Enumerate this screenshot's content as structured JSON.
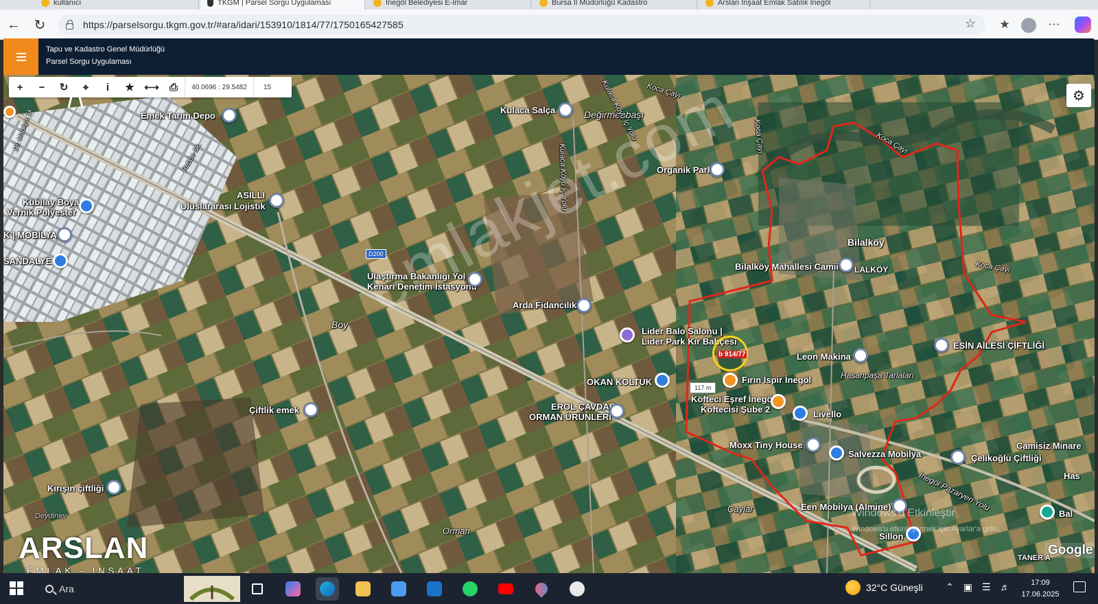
{
  "browser": {
    "tabs": [
      {
        "label": "kullanıcı"
      },
      {
        "label": "TKGM | Parsel Sorgu Uygulaması"
      },
      {
        "label": "İnegöl Belediyesi E-İmar"
      },
      {
        "label": "Bursa İl Müdürlüğü Kadastro"
      },
      {
        "label": "Arslan İnşaat Emlak Satılık İnegöl"
      }
    ],
    "url": "https://parselsorgu.tkgm.gov.tr/#ara/idari/153910/1814/77/1750165427585"
  },
  "app": {
    "title_line1": "Tapu ve Kadastro Genel Müdürlüğü",
    "title_line2": "Parsel Sorgu Uygulaması"
  },
  "map_toolbar": {
    "coordinates": "40.0696 : 29.5482",
    "zoom": "15"
  },
  "map": {
    "places": [
      {
        "id": "emek-tarim-depo",
        "label": "Emek Tarım Depo",
        "pin": "grey"
      },
      {
        "id": "kulaca-salca",
        "label": "Kulaca Salça",
        "pin": "grey"
      },
      {
        "id": "organik-park",
        "label": "Organik Park",
        "pin": "grey"
      },
      {
        "id": "asilli",
        "label": "ASILLI",
        "pin": "grey"
      },
      {
        "id": "uluslararasi-lojistik",
        "label": "Uluslararası Lojistik",
        "pin": "none"
      },
      {
        "id": "kubilay-boya",
        "label": "Kubilay Boya",
        "pin": "blue"
      },
      {
        "id": "vernik-polyester",
        "label": "Vernik Polyester",
        "pin": "none"
      },
      {
        "id": "k-mobilya",
        "label": "K | MOBİLYA",
        "pin": "grey"
      },
      {
        "id": "sandalye",
        "label": "SANDALYE",
        "pin": "blue"
      },
      {
        "id": "bilalkoy-camii",
        "label": "Bilalköy Mahallesi Camii",
        "pin": "grey"
      },
      {
        "id": "ulastirma-1",
        "label": "Ulaştırma Bakanlığı Yol",
        "pin": "grey"
      },
      {
        "id": "ulastirma-2",
        "label": "Kenarı Denetim İstasyonu",
        "pin": "none"
      },
      {
        "id": "arda-fidancilik",
        "label": "Arda Fidancılık",
        "pin": "grey"
      },
      {
        "id": "lider-balo-1",
        "label": "Lider Balo Salonu |",
        "pin": "purple"
      },
      {
        "id": "lider-balo-2",
        "label": "Lider Park Kır Bahçesi",
        "pin": "none"
      },
      {
        "id": "leon-makina",
        "label": "Leon Makina",
        "pin": "grey"
      },
      {
        "id": "esin-ailesi",
        "label": "ESİN AİLESİ ÇİFTLİĞİ",
        "pin": "grey"
      },
      {
        "id": "firin-ispir",
        "label": "Fırın İspir İnegöl",
        "pin": "orange"
      },
      {
        "id": "okan-koltuk",
        "label": "OKAN KOLTUK",
        "pin": "blue"
      },
      {
        "id": "koftecisi-1",
        "label": "Köfteci Eşref İnegöl",
        "pin": "orange"
      },
      {
        "id": "koftecisi-2",
        "label": "Köftecisi Şube 2",
        "pin": "none"
      },
      {
        "id": "livello",
        "label": "Livello",
        "pin": "blue"
      },
      {
        "id": "ciftlik-emek",
        "label": "Çiftlik emek",
        "pin": "grey"
      },
      {
        "id": "erol-cavdar-1",
        "label": "EROL ÇAVDAR",
        "pin": "grey"
      },
      {
        "id": "erol-cavdar-2",
        "label": "ORMAN ÜRÜNLERİ",
        "pin": "none"
      },
      {
        "id": "moxx",
        "label": "Moxx Tiny House",
        "pin": "grey"
      },
      {
        "id": "salvezza",
        "label": "Salvezza Mobilya",
        "pin": "blue"
      },
      {
        "id": "camisiz-minare",
        "label": "Camisiz Minare",
        "pin": "none"
      },
      {
        "id": "celikoglu",
        "label": "Çelikoğlu Çiftliği",
        "pin": "grey"
      },
      {
        "id": "kirisin",
        "label": "Kırışın çiftliği",
        "pin": "grey"
      },
      {
        "id": "een-mobilya",
        "label": "Een Mobilya (Almine)",
        "pin": "grey"
      },
      {
        "id": "sillon",
        "label": "Sillon",
        "pin": "blue"
      },
      {
        "id": "bal",
        "label": "Bal",
        "pin": "teal"
      },
      {
        "id": "has",
        "label": "Has",
        "pin": "none"
      },
      {
        "id": "taner",
        "label": "TANER A",
        "pin": "none"
      }
    ],
    "areas": [
      {
        "id": "bilalkoy",
        "label": "Bilalköy"
      },
      {
        "id": "bilalkoy-short",
        "label": "LALKÖY"
      },
      {
        "id": "degirmenbasi",
        "label": "Değirmenbaşı"
      },
      {
        "id": "boy",
        "label": "Boy"
      },
      {
        "id": "hasanpasa",
        "label": "Hasanpaşa Tarlaları"
      },
      {
        "id": "caylar",
        "label": "Çaylar"
      },
      {
        "id": "orman",
        "label": "Orman"
      },
      {
        "id": "deydinler",
        "label": "Deydinler"
      }
    ],
    "streets": [
      {
        "id": "koca-cayi-1",
        "label": "Koca Çayı"
      },
      {
        "id": "koca-cayi-2",
        "label": "Koca Çayı"
      },
      {
        "id": "koca-cayi-3",
        "label": "Koca Çayı"
      },
      {
        "id": "koca-cayi-4",
        "label": "Koca Çayı"
      },
      {
        "id": "kulaca-yolu-1",
        "label": "Kulaca Köyü İç Yolu"
      },
      {
        "id": "kulaca-yolu-2",
        "label": "Kulaca Köyü İç Yolu"
      },
      {
        "id": "mobilya-sk",
        "label": "19. Mobilya Sk."
      },
      {
        "id": "rebbe-sk",
        "label": "Rebbe Sk."
      },
      {
        "id": "pazaryeri-yolu",
        "label": "İnegöl Pazaryeri Yolu"
      }
    ],
    "road_badge": "D200",
    "parcel_label": "b 914/77",
    "scale": "117 m",
    "watermark": "emlakjet.com",
    "brand_name": "ARSLAN",
    "brand_sub": "EMLAK - İNŞAAT",
    "windows_activate_1": "Windows'u Etkinleştir",
    "windows_activate_2": "Windows'u etkinleştirmek için Ayarlar'a gidin.",
    "google": "Google"
  },
  "taskbar": {
    "search_label": "Ara",
    "weather": "32°C Güneşli",
    "time": "17:09",
    "date": "17.06.2025"
  },
  "colors": {
    "header_bg": "#0d1e33",
    "menu_orange": "#f08a1c",
    "boundary_red": "#e0261b",
    "parcel_ring": "#f7d21a"
  }
}
